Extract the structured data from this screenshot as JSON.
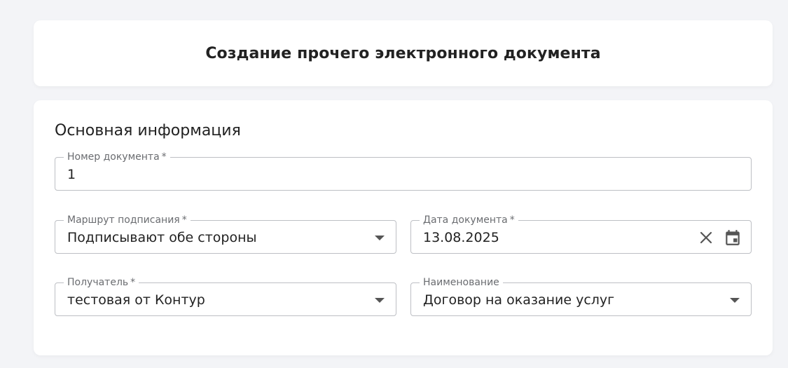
{
  "header": {
    "title": "Создание прочего электронного документа"
  },
  "form": {
    "section_title": "Основная информация",
    "fields": {
      "doc_number": {
        "label": "Номер документа",
        "required_mark": "*",
        "value": "1"
      },
      "signing_route": {
        "label": "Маршрут подписания",
        "required_mark": "*",
        "value": "Подписывают обе стороны"
      },
      "doc_date": {
        "label": "Дата документа",
        "required_mark": "*",
        "value": "13.08.2025"
      },
      "recipient": {
        "label": "Получатель",
        "required_mark": "*",
        "value": "тестовая от Контур"
      },
      "name": {
        "label": "Наименование",
        "value": "Договор на оказание услуг"
      }
    }
  },
  "icons": {
    "clear": "close-icon",
    "calendar": "calendar-icon",
    "dropdown": "chevron-down-icon"
  }
}
